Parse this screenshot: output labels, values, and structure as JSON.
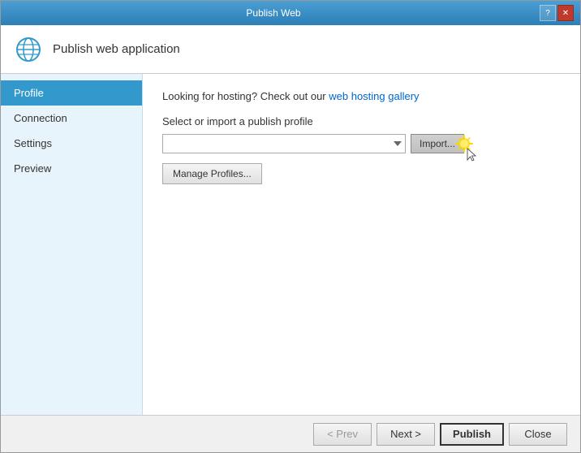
{
  "window": {
    "title": "Publish Web",
    "help_btn": "?",
    "close_btn": "✕"
  },
  "header": {
    "title": "Publish web application",
    "icon": "globe"
  },
  "sidebar": {
    "items": [
      {
        "id": "profile",
        "label": "Profile",
        "active": true
      },
      {
        "id": "connection",
        "label": "Connection",
        "active": false
      },
      {
        "id": "settings",
        "label": "Settings",
        "active": false
      },
      {
        "id": "preview",
        "label": "Preview",
        "active": false
      }
    ]
  },
  "main": {
    "hosting_text": "Looking for hosting? Check out our ",
    "hosting_link_label": "web hosting gallery",
    "select_label": "Select or import a publish profile",
    "profile_dropdown_value": "",
    "profile_dropdown_placeholder": "",
    "import_btn_label": "Import...",
    "manage_profiles_btn_label": "Manage Profiles..."
  },
  "footer": {
    "prev_label": "< Prev",
    "next_label": "Next >",
    "publish_label": "Publish",
    "close_label": "Close"
  }
}
